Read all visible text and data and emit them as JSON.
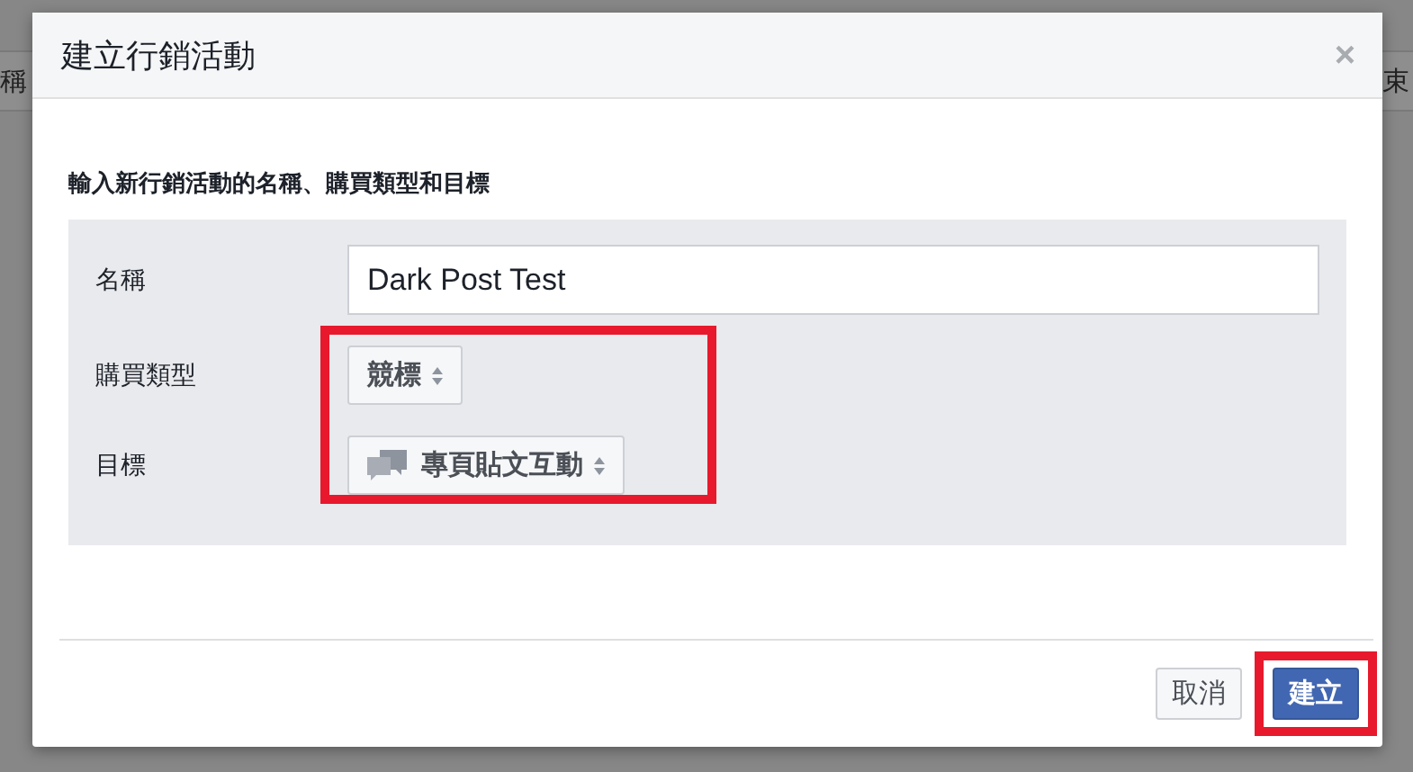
{
  "background": {
    "left_text": "稱",
    "right_text": "束"
  },
  "dialog": {
    "title": "建立行銷活動",
    "close": "×",
    "instruction": "輸入新行銷活動的名稱、購買類型和目標",
    "fields": [
      {
        "kind": "text",
        "label": "名稱",
        "value": "Dark Post Test",
        "highlighted": false
      },
      {
        "kind": "select",
        "label": "購買類型",
        "value": "競標",
        "icon": false,
        "highlighted": true
      },
      {
        "kind": "select",
        "label": "目標",
        "value": "專頁貼文互動",
        "icon": true,
        "highlighted": true
      }
    ],
    "buttons": [
      {
        "label": "取消",
        "kind": "secondary",
        "highlighted": false
      },
      {
        "label": "建立",
        "kind": "primary",
        "highlighted": true
      }
    ]
  }
}
